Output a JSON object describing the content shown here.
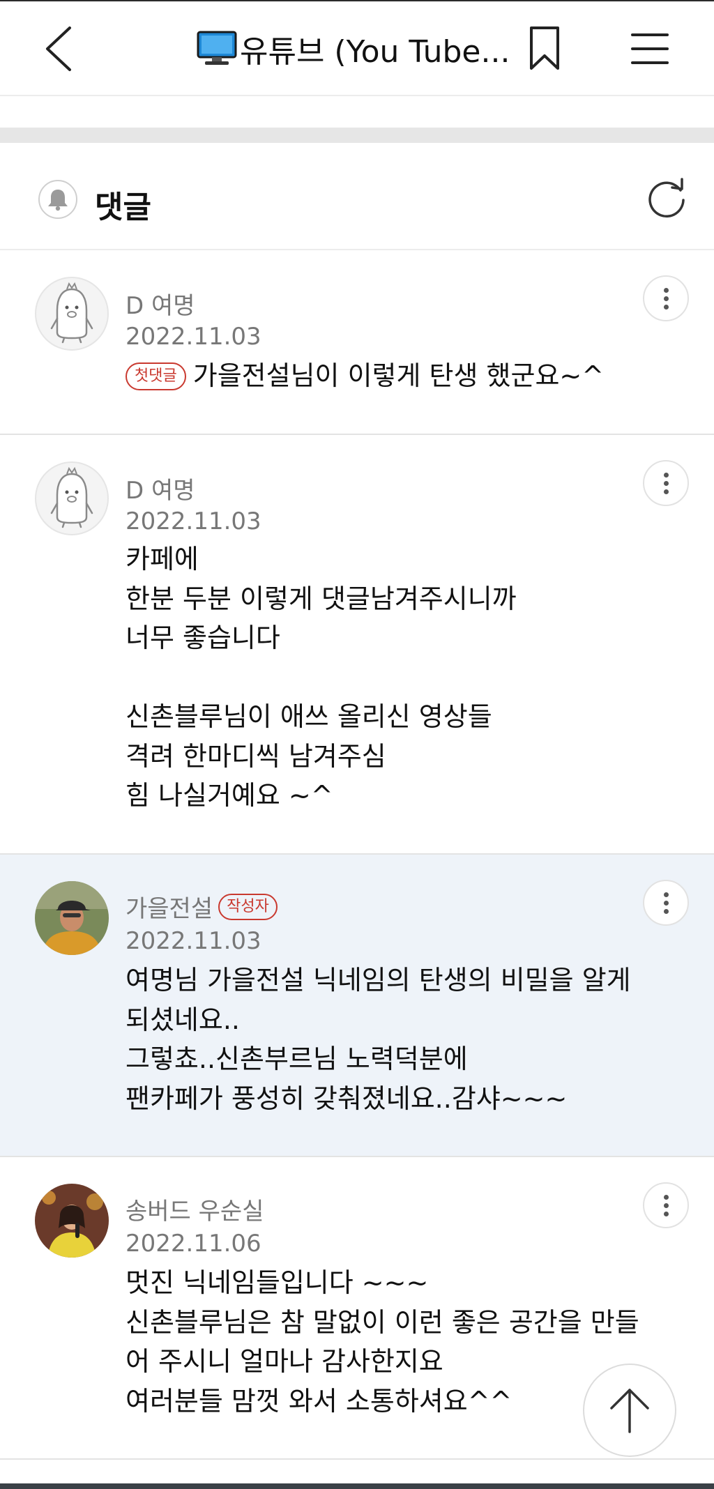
{
  "header": {
    "title": "유튜브 (You Tube...",
    "back_icon": "chevron-left-icon",
    "title_icon": "desktop-computer-icon",
    "bookmark_icon": "bookmark-icon",
    "menu_icon": "hamburger-menu-icon"
  },
  "comments_section": {
    "label": "댓글",
    "bell_icon": "bell-icon",
    "refresh_icon": "refresh-icon"
  },
  "comments": [
    {
      "author": "D 여명",
      "date": "2022.11.03",
      "badge": "첫댓글",
      "text": "가을전설님이 이렇게 탄생 했군요~^",
      "avatar": "default-penguin-avatar"
    },
    {
      "author": "D 여명",
      "date": "2022.11.03",
      "text": "카페에\n한분 두분 이렇게 댓글남겨주시니까\n너무 좋습니다\n\n신촌블루님이 애쓰 올리신 영상들\n격려 한마디씩 남겨주심\n힘 나실거예요 ~^",
      "avatar": "default-penguin-avatar"
    },
    {
      "author": "가을전설",
      "author_badge": "작성자",
      "date": "2022.11.03",
      "text": "여명님 가을전설 닉네임의 탄생의 비밀을 알게\n되셨네요..\n그렇쵸..신촌부르님 노력덕분에\n팬카페가 풍성히 갖춰졌네요..감샤~~~",
      "avatar": "profile-photo-man-cap",
      "highlighted": true
    },
    {
      "author": "송버드 우순실",
      "date": "2022.11.06",
      "text": "멋진 닉네임들입니다 ~~~\n신촌블루님은 참 말없이 이런 좋은 공간을 만들\n어 주시니 얼마나 감사한지요\n여러분들 맘껏 와서 소통하셔요^^",
      "avatar": "profile-photo-singer-yellow"
    }
  ],
  "scroll_top_icon": "arrow-up-icon",
  "colors": {
    "badge_red": "#c9392f",
    "highlight_bg": "#eef3f9",
    "meta_gray": "#777777",
    "monitor_blue": "#1e88d6"
  }
}
